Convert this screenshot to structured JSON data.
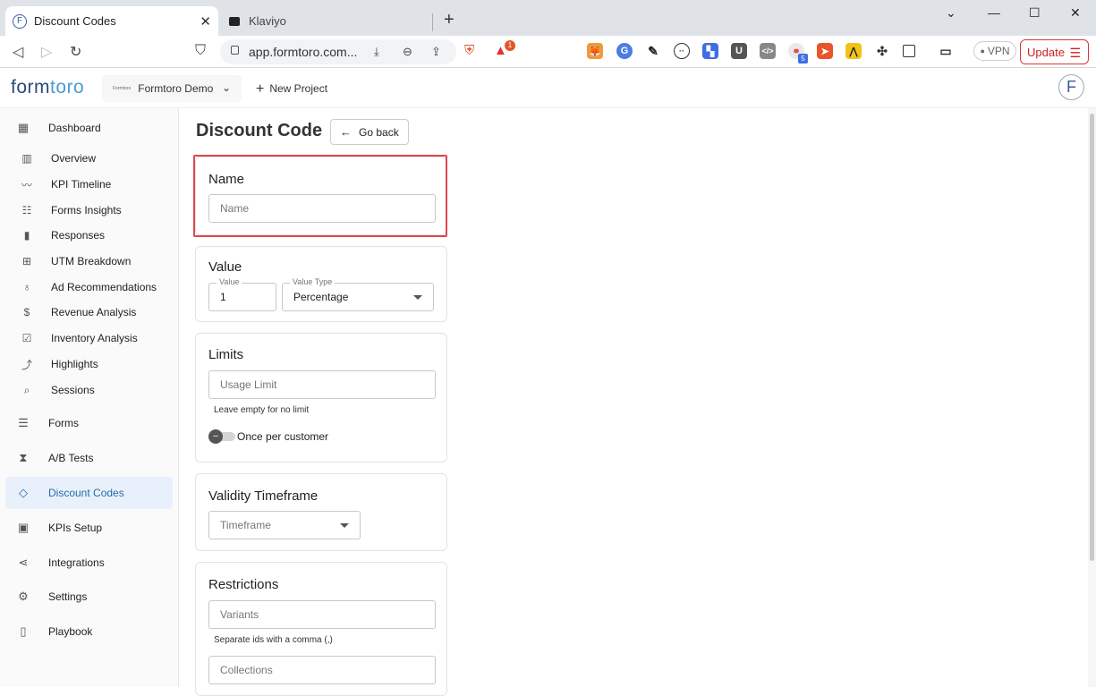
{
  "browser": {
    "tabs": [
      {
        "title": "Discount Codes",
        "favicon": "F"
      },
      {
        "title": "Klaviyo"
      }
    ],
    "url": "app.formtoro.com...",
    "vpn_label": "VPN",
    "update_label": "Update",
    "brave_badge": "1",
    "ext_badge": "5"
  },
  "app": {
    "logo_a": "form",
    "logo_b": "toro",
    "project_mini": "Formtoro",
    "project_name": "Formtoro Demo",
    "new_project": "New Project",
    "avatar_letter": "F"
  },
  "sidebar": {
    "items": [
      {
        "label": "Dashboard",
        "icon": "dashboard-icon"
      },
      {
        "label": "Overview",
        "icon": "bar-chart-icon"
      },
      {
        "label": "KPI Timeline",
        "icon": "timeline-icon"
      },
      {
        "label": "Forms Insights",
        "icon": "insights-icon"
      },
      {
        "label": "Responses",
        "icon": "responses-icon"
      },
      {
        "label": "UTM Breakdown",
        "icon": "table-icon"
      },
      {
        "label": "Ad Recommendations",
        "icon": "bulb-icon"
      },
      {
        "label": "Revenue Analysis",
        "icon": "dollar-icon"
      },
      {
        "label": "Inventory Analysis",
        "icon": "clipboard-icon"
      },
      {
        "label": "Highlights",
        "icon": "trend-icon"
      },
      {
        "label": "Sessions",
        "icon": "sessions-icon"
      },
      {
        "label": "Forms",
        "icon": "forms-icon"
      },
      {
        "label": "A/B Tests",
        "icon": "hourglass-icon"
      },
      {
        "label": "Discount Codes",
        "icon": "tag-icon"
      },
      {
        "label": "KPIs Setup",
        "icon": "kpi-icon"
      },
      {
        "label": "Integrations",
        "icon": "share-icon"
      },
      {
        "label": "Settings",
        "icon": "gear-icon"
      },
      {
        "label": "Playbook",
        "icon": "book-icon"
      }
    ]
  },
  "page": {
    "title": "Discount Code",
    "go_back": "Go back"
  },
  "name_card": {
    "heading": "Name",
    "placeholder": "Name"
  },
  "value_card": {
    "heading": "Value",
    "value_label": "Value",
    "value": "1",
    "type_label": "Value Type",
    "type_value": "Percentage"
  },
  "limits_card": {
    "heading": "Limits",
    "usage_placeholder": "Usage Limit",
    "helper": "Leave empty for no limit",
    "toggle_label": "Once per customer"
  },
  "validity_card": {
    "heading": "Validity Timeframe",
    "timeframe_placeholder": "Timeframe"
  },
  "restrictions_card": {
    "heading": "Restrictions",
    "variants_placeholder": "Variants",
    "helper": "Separate ids with a comma (,)",
    "collections_placeholder": "Collections"
  },
  "colors": {
    "accent": "#2a6aa8",
    "highlight": "#e0474c"
  }
}
